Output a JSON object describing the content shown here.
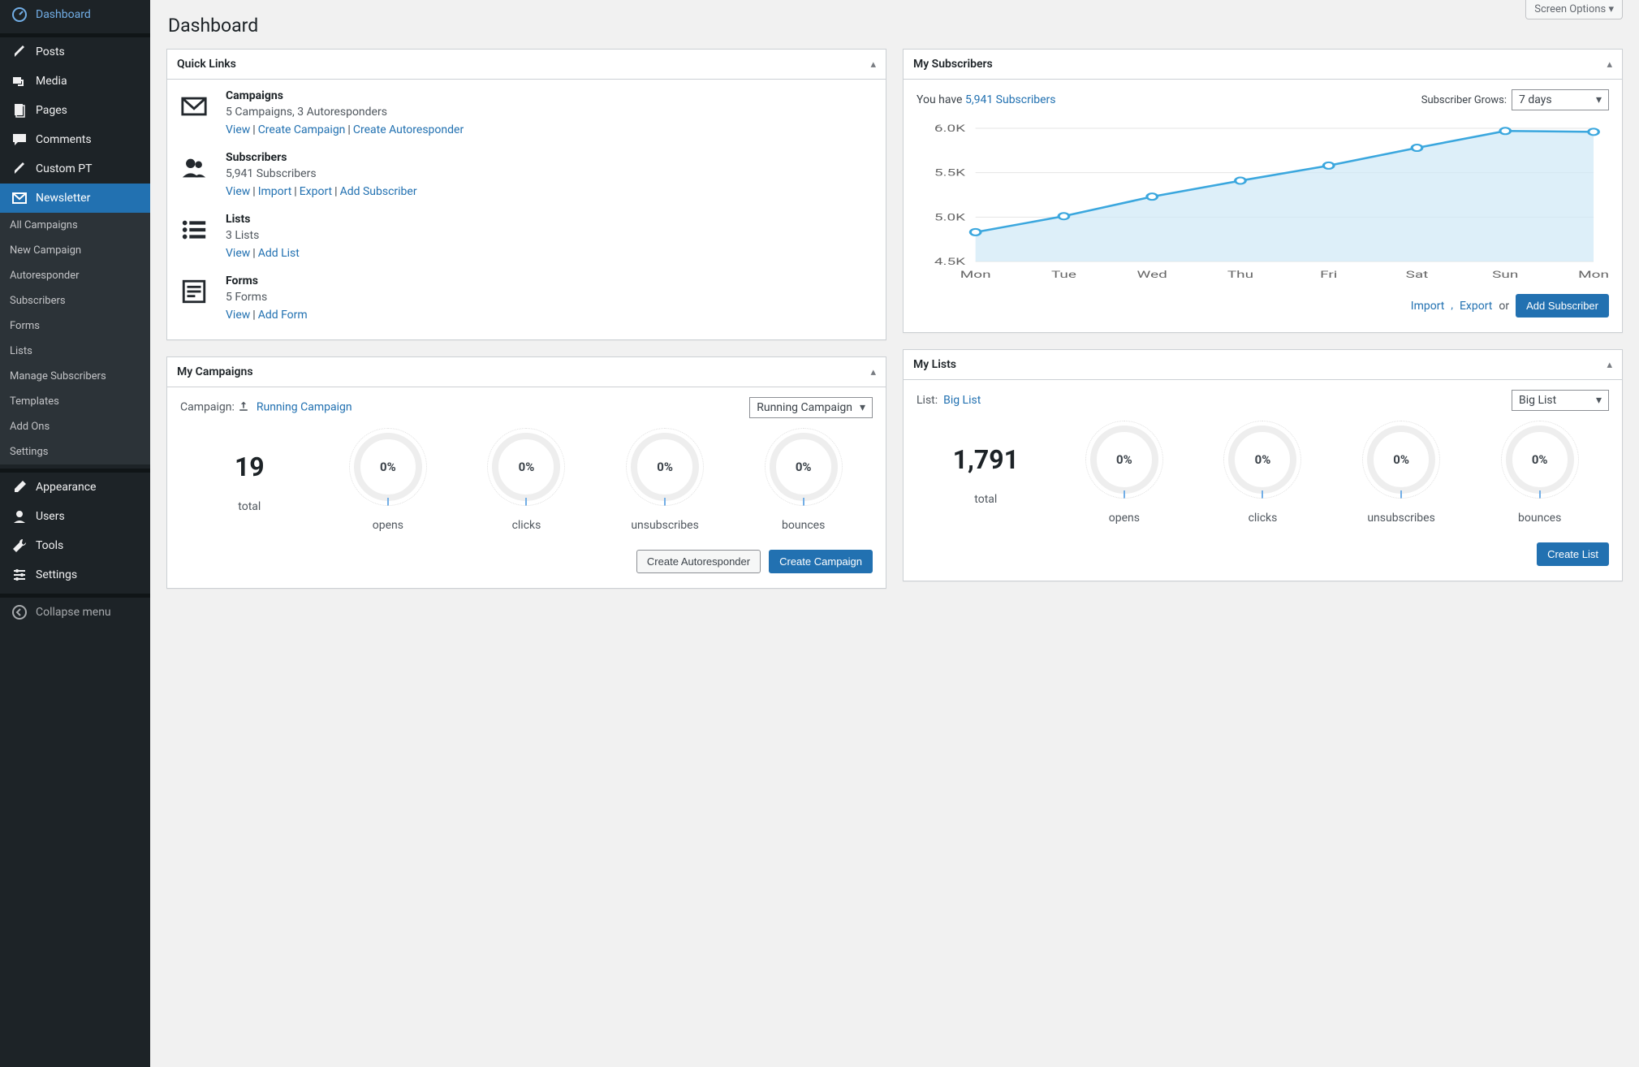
{
  "screen_options": "Screen Options",
  "page_title": "Dashboard",
  "sidebar": {
    "items": [
      {
        "label": "Dashboard",
        "icon": "dashboard"
      },
      {
        "label": "Posts",
        "icon": "pin"
      },
      {
        "label": "Media",
        "icon": "media"
      },
      {
        "label": "Pages",
        "icon": "pages"
      },
      {
        "label": "Comments",
        "icon": "comments"
      },
      {
        "label": "Custom PT",
        "icon": "pin"
      },
      {
        "label": "Newsletter",
        "icon": "envelope",
        "active": true
      },
      {
        "label": "Appearance",
        "icon": "brush"
      },
      {
        "label": "Users",
        "icon": "user"
      },
      {
        "label": "Tools",
        "icon": "wrench"
      },
      {
        "label": "Settings",
        "icon": "settings"
      }
    ],
    "submenu": [
      "All Campaigns",
      "New Campaign",
      "Autoresponder",
      "Subscribers",
      "Forms",
      "Lists",
      "Manage Subscribers",
      "Templates",
      "Add Ons",
      "Settings"
    ],
    "collapse": "Collapse menu"
  },
  "quick_links": {
    "title": "Quick Links",
    "rows": [
      {
        "title": "Campaigns",
        "sub": "5 Campaigns, 3 Autoresponders",
        "links": [
          "View",
          "Create Campaign",
          "Create Autoresponder"
        ]
      },
      {
        "title": "Subscribers",
        "sub": "5,941 Subscribers",
        "links": [
          "View",
          "Import",
          "Export",
          "Add Subscriber"
        ]
      },
      {
        "title": "Lists",
        "sub": "3 Lists",
        "links": [
          "View",
          "Add List"
        ]
      },
      {
        "title": "Forms",
        "sub": "5 Forms",
        "links": [
          "View",
          "Add Form"
        ]
      }
    ]
  },
  "my_campaigns": {
    "title": "My Campaigns",
    "label": "Campaign:",
    "selected_link": "Running Campaign",
    "selected_value": "Running Campaign",
    "total": "19",
    "stats": [
      {
        "value": "0%",
        "label": "opens"
      },
      {
        "value": "0%",
        "label": "clicks"
      },
      {
        "value": "0%",
        "label": "unsubscribes"
      },
      {
        "value": "0%",
        "label": "bounces"
      }
    ],
    "total_label": "total",
    "btn_secondary": "Create Autoresponder",
    "btn_primary": "Create Campaign"
  },
  "my_subscribers": {
    "title": "My Subscribers",
    "you_have_prefix": "You have",
    "count_link": "5,941 Subscribers",
    "grows_label": "Subscriber Grows:",
    "grows_value": "7 days",
    "import": "Import",
    "export": "Export",
    "or": "or",
    "add_btn": "Add Subscriber"
  },
  "my_lists": {
    "title": "My Lists",
    "label": "List:",
    "selected_link": "Big List",
    "selected_value": "Big List",
    "total": "1,791",
    "stats": [
      {
        "value": "0%",
        "label": "opens"
      },
      {
        "value": "0%",
        "label": "clicks"
      },
      {
        "value": "0%",
        "label": "unsubscribes"
      },
      {
        "value": "0%",
        "label": "bounces"
      }
    ],
    "total_label": "total",
    "btn_primary": "Create List"
  },
  "chart_data": {
    "type": "line",
    "title": "",
    "xlabel": "",
    "ylabel": "",
    "categories": [
      "Mon",
      "Tue",
      "Wed",
      "Thu",
      "Fri",
      "Sat",
      "Sun",
      "Mon"
    ],
    "values": [
      4830,
      5010,
      5230,
      5410,
      5580,
      5780,
      5970,
      5960
    ],
    "ylim": [
      4500,
      6000
    ],
    "y_ticks": [
      "6.0K",
      "5.5K",
      "5.0K",
      "4.5K"
    ]
  }
}
